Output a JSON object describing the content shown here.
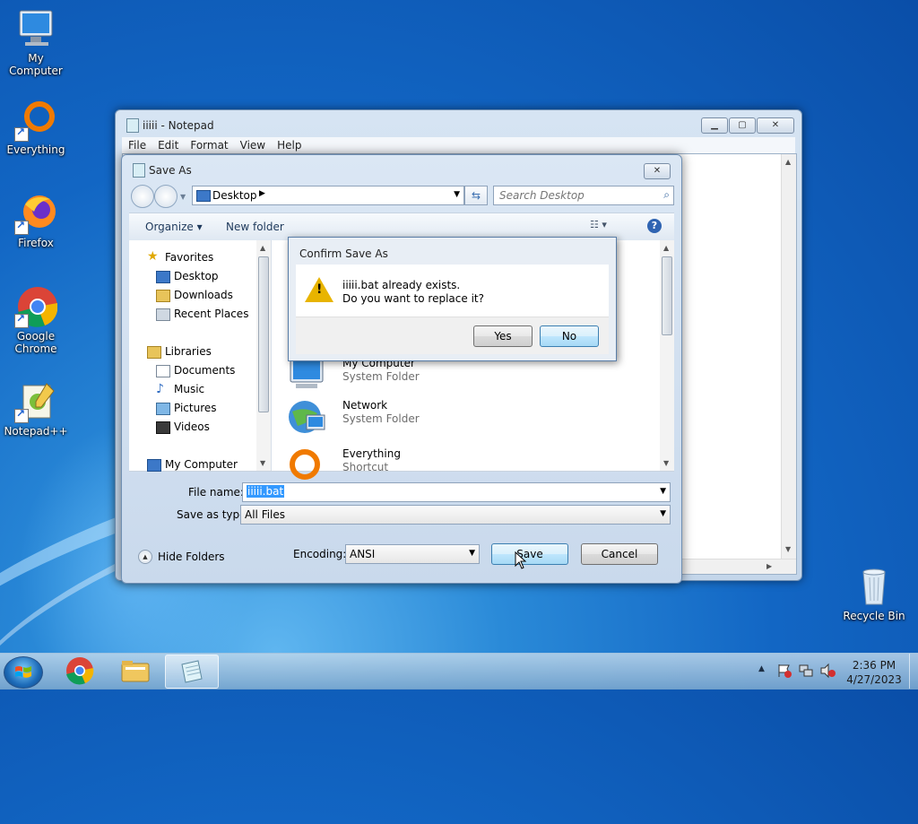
{
  "desktop": {
    "icons": [
      {
        "label": "My Computer"
      },
      {
        "label": "Everything"
      },
      {
        "label": "Firefox"
      },
      {
        "label": "Google Chrome"
      },
      {
        "label": "Notepad++"
      },
      {
        "label": "Recycle Bin"
      }
    ]
  },
  "notepad": {
    "title": "iiiii - Notepad",
    "menu": [
      "File",
      "Edit",
      "Format",
      "View",
      "Help"
    ]
  },
  "save_as": {
    "title": "Save As",
    "address": "Desktop",
    "search_placeholder": "Search Desktop",
    "organize": "Organize ▾",
    "new_folder": "New folder",
    "nav": {
      "favorites": "Favorites",
      "desktop": "Desktop",
      "downloads": "Downloads",
      "recent": "Recent Places",
      "libraries": "Libraries",
      "documents": "Documents",
      "music": "Music",
      "pictures": "Pictures",
      "videos": "Videos",
      "computer": "My Computer"
    },
    "files": [
      {
        "name": "My Computer",
        "type": "System Folder"
      },
      {
        "name": "Network",
        "type": "System Folder"
      },
      {
        "name": "Everything",
        "type": "Shortcut"
      }
    ],
    "file_name_label": "File name:",
    "file_name_value": "iiiii.bat",
    "save_type_label": "Save as type:",
    "save_type_value": "All Files",
    "hide_folders": "Hide Folders",
    "encoding_label": "Encoding:",
    "encoding_value": "ANSI",
    "save_button": "Save",
    "cancel_button": "Cancel"
  },
  "confirm": {
    "title": "Confirm Save As",
    "line1": "iiiii.bat already exists.",
    "line2": "Do you want to replace it?",
    "yes": "Yes",
    "no": "No"
  },
  "taskbar": {
    "time": "2:36 PM",
    "date": "4/27/2023"
  }
}
